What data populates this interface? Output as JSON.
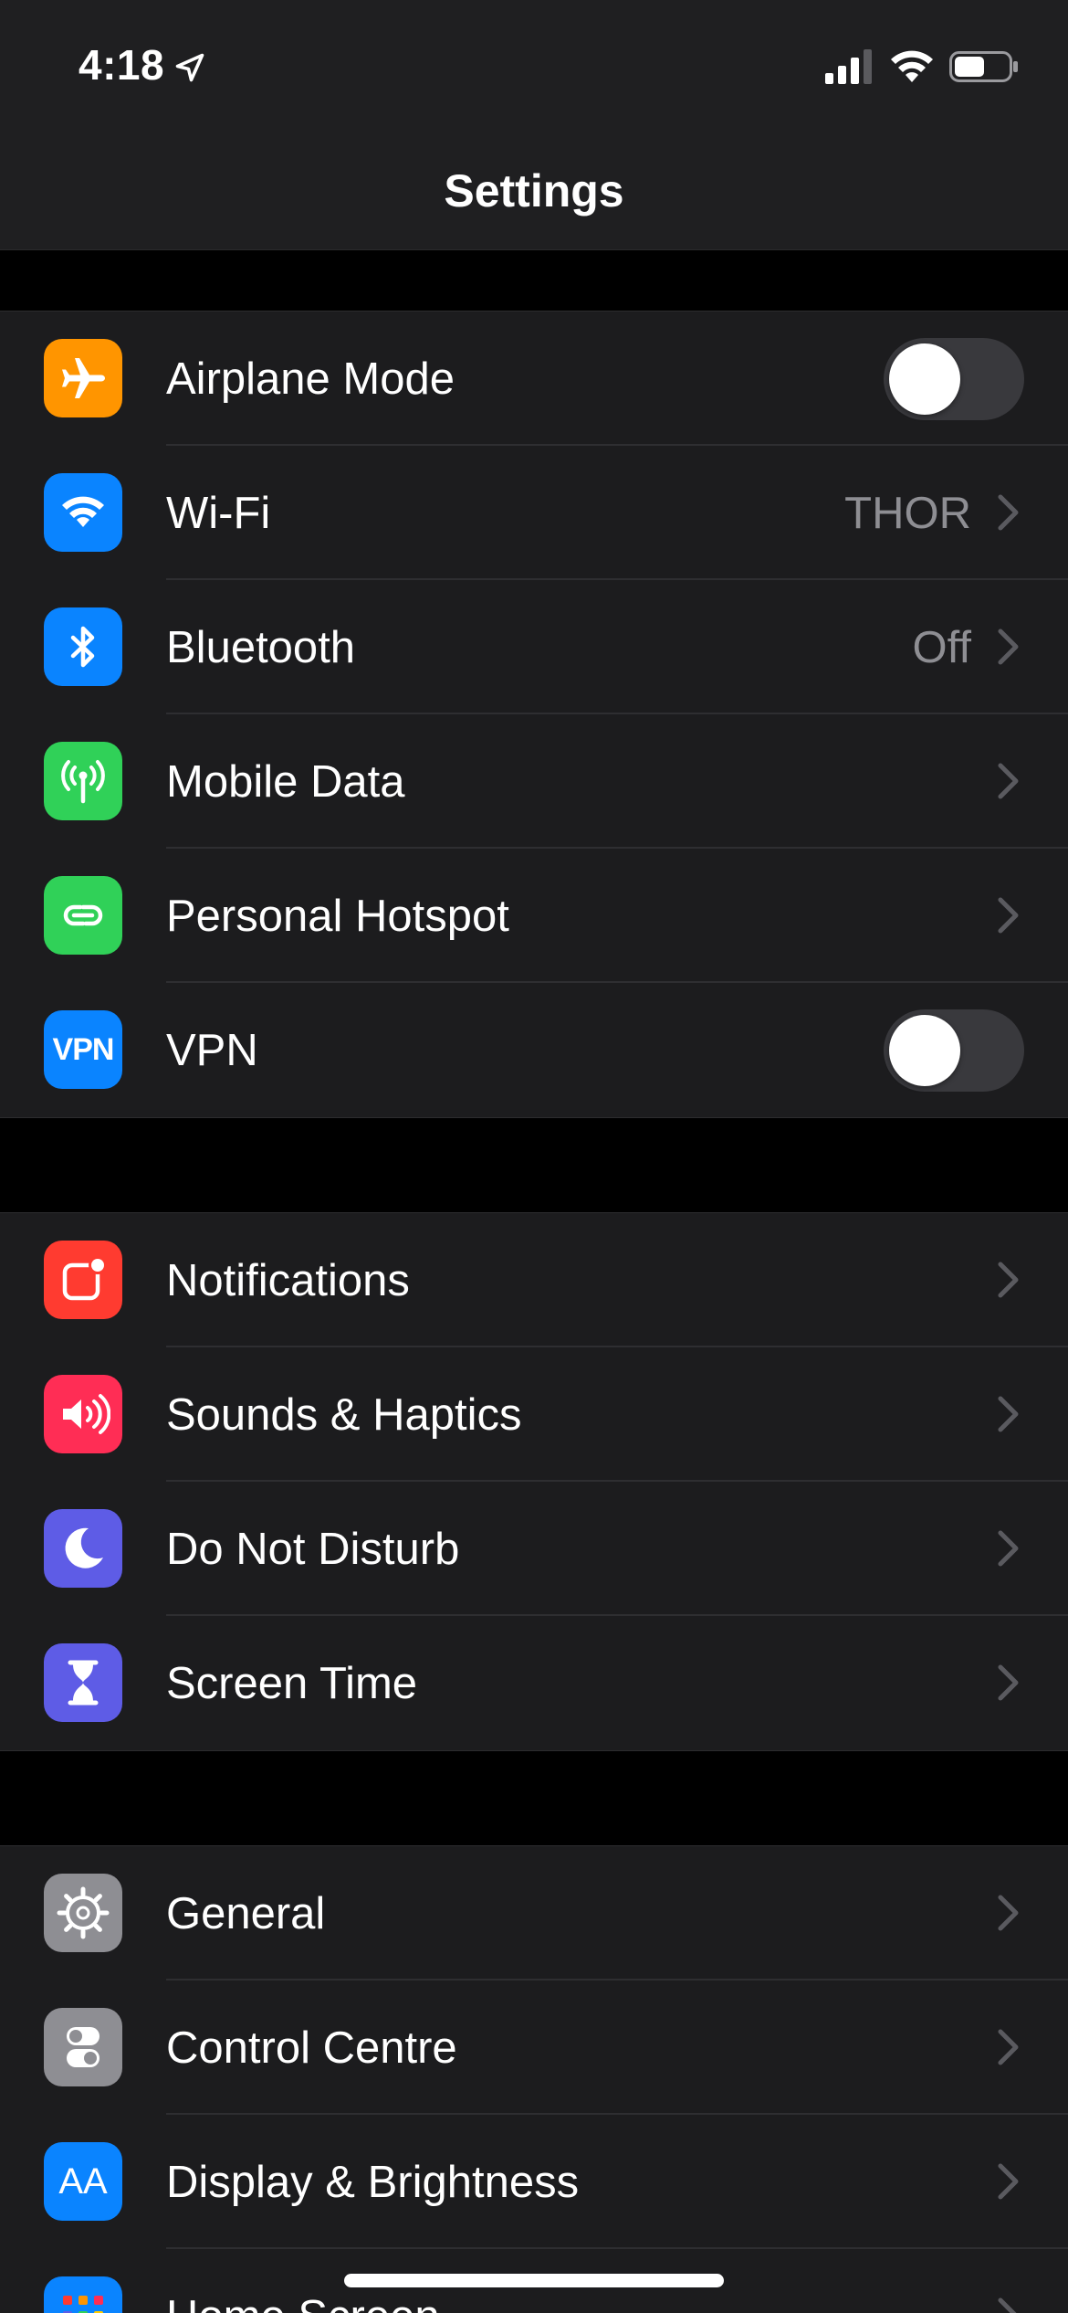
{
  "status_bar": {
    "time": "4:18",
    "icons": [
      "location-arrow-icon",
      "cellular-signal-icon",
      "wifi-icon",
      "battery-icon"
    ],
    "battery_level": 0.55
  },
  "nav": {
    "title": "Settings"
  },
  "groups": [
    {
      "rows": [
        {
          "label": "Airplane Mode",
          "icon": "airplane-icon",
          "color": "#ff9500",
          "control": "toggle",
          "on": false
        },
        {
          "label": "Wi-Fi",
          "icon": "wifi-icon",
          "color": "#0a84ff",
          "value": "THOR",
          "control": "chevron"
        },
        {
          "label": "Bluetooth",
          "icon": "bluetooth-icon",
          "color": "#0a84ff",
          "value": "Off",
          "control": "chevron"
        },
        {
          "label": "Mobile Data",
          "icon": "antenna-icon",
          "color": "#30d158",
          "control": "chevron"
        },
        {
          "label": "Personal Hotspot",
          "icon": "hotspot-link-icon",
          "color": "#30d158",
          "control": "chevron"
        },
        {
          "label": "VPN",
          "icon": "vpn-icon",
          "icon_text": "VPN",
          "color": "#0a84ff",
          "control": "toggle",
          "on": false
        }
      ]
    },
    {
      "rows": [
        {
          "label": "Notifications",
          "icon": "notifications-icon",
          "color": "#ff3b30",
          "control": "chevron"
        },
        {
          "label": "Sounds & Haptics",
          "icon": "speaker-icon",
          "color": "#ff2d55",
          "control": "chevron"
        },
        {
          "label": "Do Not Disturb",
          "icon": "moon-icon",
          "color": "#5e5ce6",
          "control": "chevron"
        },
        {
          "label": "Screen Time",
          "icon": "hourglass-icon",
          "color": "#5e5ce6",
          "control": "chevron"
        }
      ]
    },
    {
      "rows": [
        {
          "label": "General",
          "icon": "gear-icon",
          "color": "#8e8e93",
          "control": "chevron"
        },
        {
          "label": "Control Centre",
          "icon": "switches-icon",
          "color": "#8e8e93",
          "control": "chevron"
        },
        {
          "label": "Display & Brightness",
          "icon": "text-size-icon",
          "icon_text": "AA",
          "color": "#0a84ff",
          "control": "chevron"
        },
        {
          "label": "Home Screen",
          "icon": "home-grid-icon",
          "color": "#0a84ff",
          "control": "chevron"
        }
      ]
    }
  ]
}
